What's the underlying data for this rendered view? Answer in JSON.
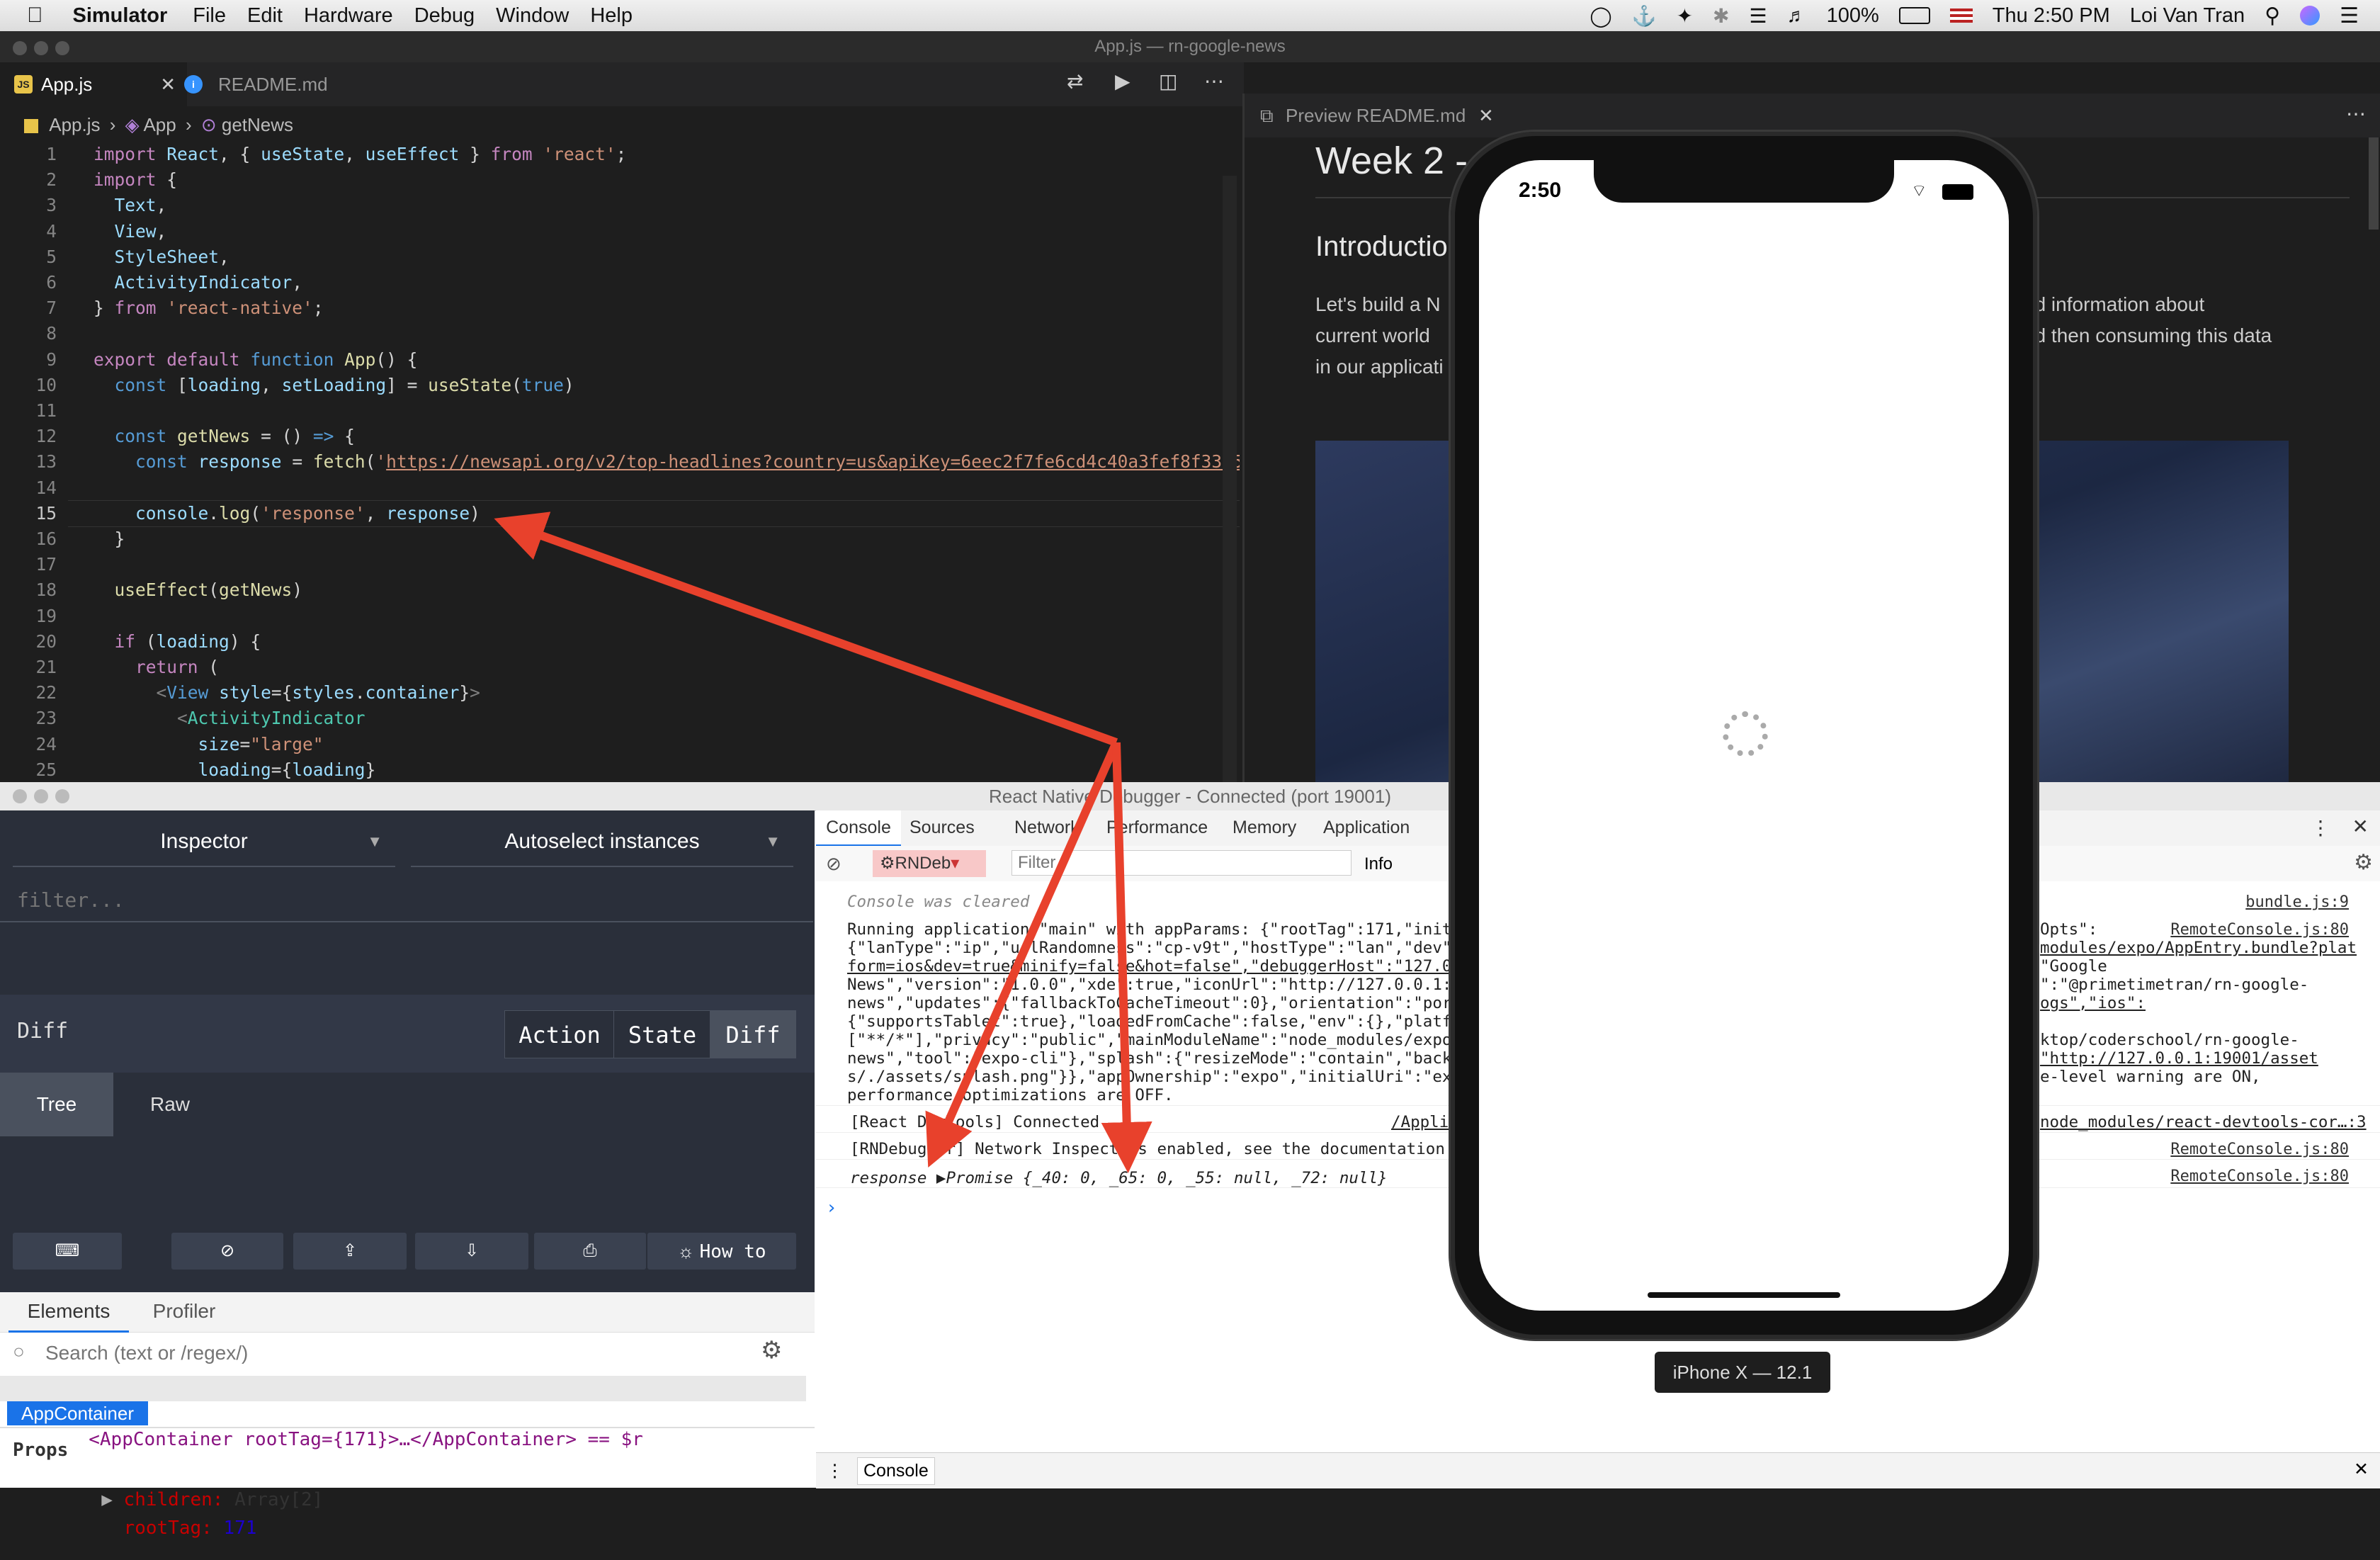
{
  "menubar": {
    "app_name": "Simulator",
    "items": [
      "File",
      "Edit",
      "Hardware",
      "Debug",
      "Window",
      "Help"
    ],
    "battery": "100%",
    "clock": "Thu 2:50 PM",
    "user": "Loi Van Tran"
  },
  "vscode": {
    "window_title": "App.js — rn-google-news",
    "tabs": [
      {
        "label": "App.js",
        "icon": "js-file-icon",
        "active": true
      },
      {
        "label": "README.md",
        "icon": "info-icon",
        "active": false
      }
    ],
    "breadcrumb": [
      "App.js",
      "App",
      "getNews"
    ],
    "preview_tab": "Preview README.md",
    "code_lines": [
      "1",
      "2",
      "3",
      "4",
      "5",
      "6",
      "7",
      "8",
      "9",
      "10",
      "11",
      "12",
      "13",
      "14",
      "15",
      "16",
      "17",
      "18",
      "19",
      "20",
      "21",
      "22",
      "23",
      "24",
      "25"
    ],
    "preview": {
      "heading": "Week 2 -",
      "subheading": "Introductio",
      "para_left": [
        "Let's build a N",
        "current world",
        "in our applicati"
      ],
      "para_right": [
        "nd information about",
        "nd then consuming this data"
      ]
    }
  },
  "debugger": {
    "window_title": "React Native Debugger - Connected (port 19001)",
    "inspector_select": "Inspector",
    "autoselect_select": "Autoselect instances",
    "filter_placeholder": "filter...",
    "diff_label": "Diff",
    "monitor_tabs": [
      "Action",
      "State",
      "Diff"
    ],
    "view_tabs": [
      "Tree",
      "Raw"
    ],
    "howto_label": "How to",
    "element_tabs": [
      "Elements",
      "Profiler"
    ],
    "search_placeholder": "Search (text or /regex/)",
    "tree_row": "<AppContainer rootTag={171}>…</AppContainer> == $r",
    "selected_node": "AppContainer",
    "props_title": "Props",
    "props": [
      {
        "key": "children:",
        "value": "Array[2]"
      },
      {
        "key": "rootTag:",
        "value": "171"
      }
    ],
    "devtools_tabs": [
      "Console",
      "Sources",
      "Network",
      "Performance",
      "Memory",
      "Application"
    ],
    "context": "RNDeb",
    "filter_label": "Filter",
    "level_label": "Info",
    "console_lines": [
      "Console was cleared",
      "Running application \"main\" with appParams: {\"rootTag\":171,\"initi",
      "{\"lanType\":\"ip\",\"urlRandomness\":\"cp-v9t\",\"hostType\":\"lan\",\"dev\":",
      "form=ios&dev=true&minify=false&hot=false\",\"debuggerHost\":\"127.0.",
      "News\",\"version\":\"1.0.0\",\"xde\":true,\"iconUrl\":\"http://127.0.0.1:1",
      "news\",\"updates\":{\"fallbackToCacheTimeout\":0},\"orientation\":\"port",
      "{\"supportsTablet\":true},\"loadedFromCache\":false,\"env\":{},\"platfo",
      "[\"**/*\"],\"privacy\":\"public\",\"mainModuleName\":\"node_modules/expo/",
      "news\",\"tool\":\"expo-cli\"},\"splash\":{\"resizeMode\":\"contain\",\"backg",
      "s/./assets/splash.png\"}},\"appOwnership\":\"expo\",\"initialUri\":\"exp",
      "performance optimizations are OFF.",
      "[React DevTools] Connected",
      "[RNDebugger] Network Inspect is enabled, see the documentation (",
      "response ▶Promise {_40: 0, _65: 0, _55: null, _72: null}"
    ],
    "console_right": [
      "Opts\":",
      "modules/expo/AppEntry.bundle?plat",
      "\"Google",
      "\":\"@primetimetran/rn-google-",
      "ogs\",\"ios\":",
      "ktop/coderschool/rn-google-",
      "\"http://127.0.0.1:19001/asset",
      "e-level warning are ON,",
      "/Applic",
      "node_modules/react-devtools-cor…:3"
    ],
    "sources": [
      "bundle.js:9",
      "RemoteConsole.js:80",
      "RemoteConsole.js:80",
      "RemoteConsole.js:80"
    ],
    "drawer_tab": "Console"
  },
  "simulator": {
    "time": "2:50",
    "device_label": "iPhone X — 12.1"
  }
}
